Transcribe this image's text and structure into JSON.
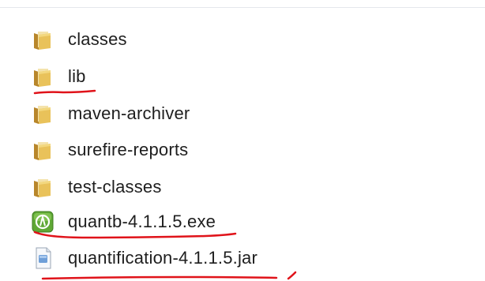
{
  "file_list": {
    "items": [
      {
        "name": "classes",
        "type": "folder"
      },
      {
        "name": "lib",
        "type": "folder"
      },
      {
        "name": "maven-archiver",
        "type": "folder"
      },
      {
        "name": "surefire-reports",
        "type": "folder"
      },
      {
        "name": "test-classes",
        "type": "folder"
      },
      {
        "name": "quantb-4.1.1.5.exe",
        "type": "executable"
      },
      {
        "name": "quantification-4.1.1.5.jar",
        "type": "jar-file"
      }
    ]
  },
  "annotations": {
    "underline_color": "#e0131a"
  },
  "colors": {
    "folder_front": "#e9c25a",
    "folder_back": "#c9962a",
    "exe_green": "#5fa835",
    "text": "#1e1e1e"
  }
}
